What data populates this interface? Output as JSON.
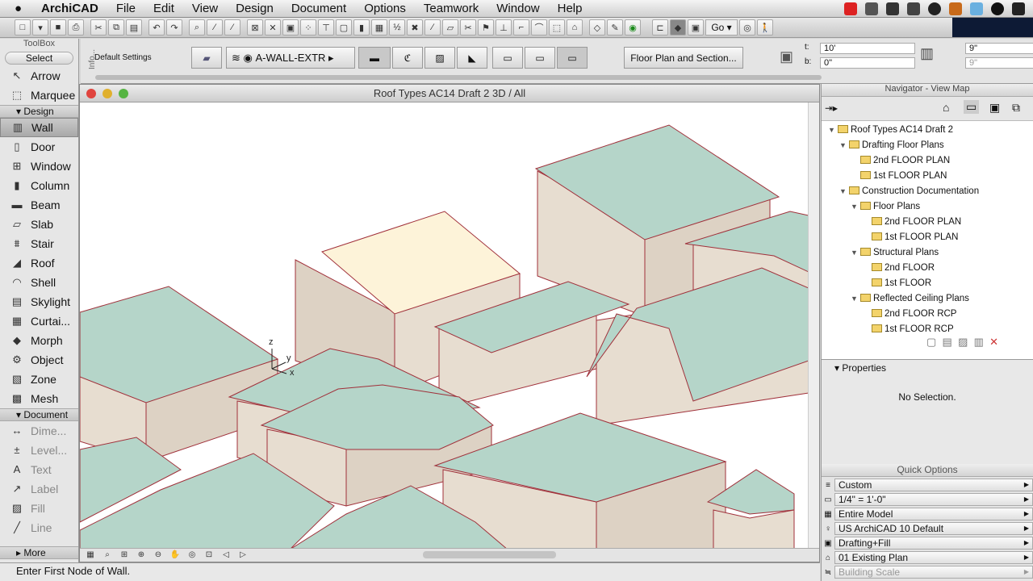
{
  "menubar": {
    "app": "ArchiCAD",
    "items": [
      "File",
      "Edit",
      "View",
      "Design",
      "Document",
      "Options",
      "Teamwork",
      "Window",
      "Help"
    ]
  },
  "toolbar": {
    "go_label": "Go"
  },
  "toolbox": {
    "title": "ToolBox",
    "select": "Select",
    "groups": {
      "design": "Design",
      "document": "Document",
      "more": "More"
    },
    "select_tools": [
      "Arrow",
      "Marquee"
    ],
    "design_tools": [
      "Wall",
      "Door",
      "Window",
      "Column",
      "Beam",
      "Slab",
      "Stair",
      "Roof",
      "Shell",
      "Skylight",
      "Curtai...",
      "Morph",
      "Object",
      "Zone",
      "Mesh"
    ],
    "document_tools": [
      "Dime...",
      "Level...",
      "Text",
      "Label",
      "Fill",
      "Line"
    ]
  },
  "infobox": {
    "label": "Info...",
    "default_settings": "Default Settings",
    "layer": "A-WALL-EXTR",
    "floor_plan_button": "Floor Plan and Section...",
    "top_label": "t:",
    "top_value": "10'",
    "bottom_label": "b:",
    "bottom_value": "0\"",
    "thickness": "9\"",
    "thickness2": "9\""
  },
  "window": {
    "title": "Roof Types AC14 Draft 2 3D / All",
    "axes": {
      "z": "z",
      "y": "y",
      "x": "x"
    }
  },
  "navigator": {
    "title": "Navigator - View Map",
    "tree": [
      {
        "label": "Roof Types AC14 Draft 2",
        "level": 0
      },
      {
        "label": "Drafting Floor Plans",
        "level": 1
      },
      {
        "label": "2nd FLOOR PLAN",
        "level": 2
      },
      {
        "label": "1st FLOOR PLAN",
        "level": 2
      },
      {
        "label": "Construction Documentation",
        "level": 1
      },
      {
        "label": "Floor Plans",
        "level": 2
      },
      {
        "label": "2nd FLOOR PLAN",
        "level": 3
      },
      {
        "label": "1st FLOOR PLAN",
        "level": 3
      },
      {
        "label": "Structural Plans",
        "level": 2
      },
      {
        "label": "2nd FLOOR",
        "level": 3
      },
      {
        "label": "1st FLOOR",
        "level": 3
      },
      {
        "label": "Reflected Ceiling Plans",
        "level": 2
      },
      {
        "label": "2nd FLOOR RCP",
        "level": 3
      },
      {
        "label": "1st FLOOR RCP",
        "level": 3
      }
    ]
  },
  "properties": {
    "title": "Properties",
    "empty": "No Selection."
  },
  "quick_options": {
    "title": "Quick Options",
    "rows": [
      "Custom",
      "1/4\"   =   1'-0\"",
      "Entire Model",
      "US ArchiCAD 10 Default",
      "Drafting+Fill",
      "01 Existing Plan",
      "Building Scale"
    ]
  },
  "status": {
    "text": "Enter First Node of Wall."
  },
  "colors": {
    "roof": "#b5d5c9",
    "wall": "#e7ddd0",
    "selected_roof": "#fdf3d9",
    "edge": "#a0303a"
  }
}
